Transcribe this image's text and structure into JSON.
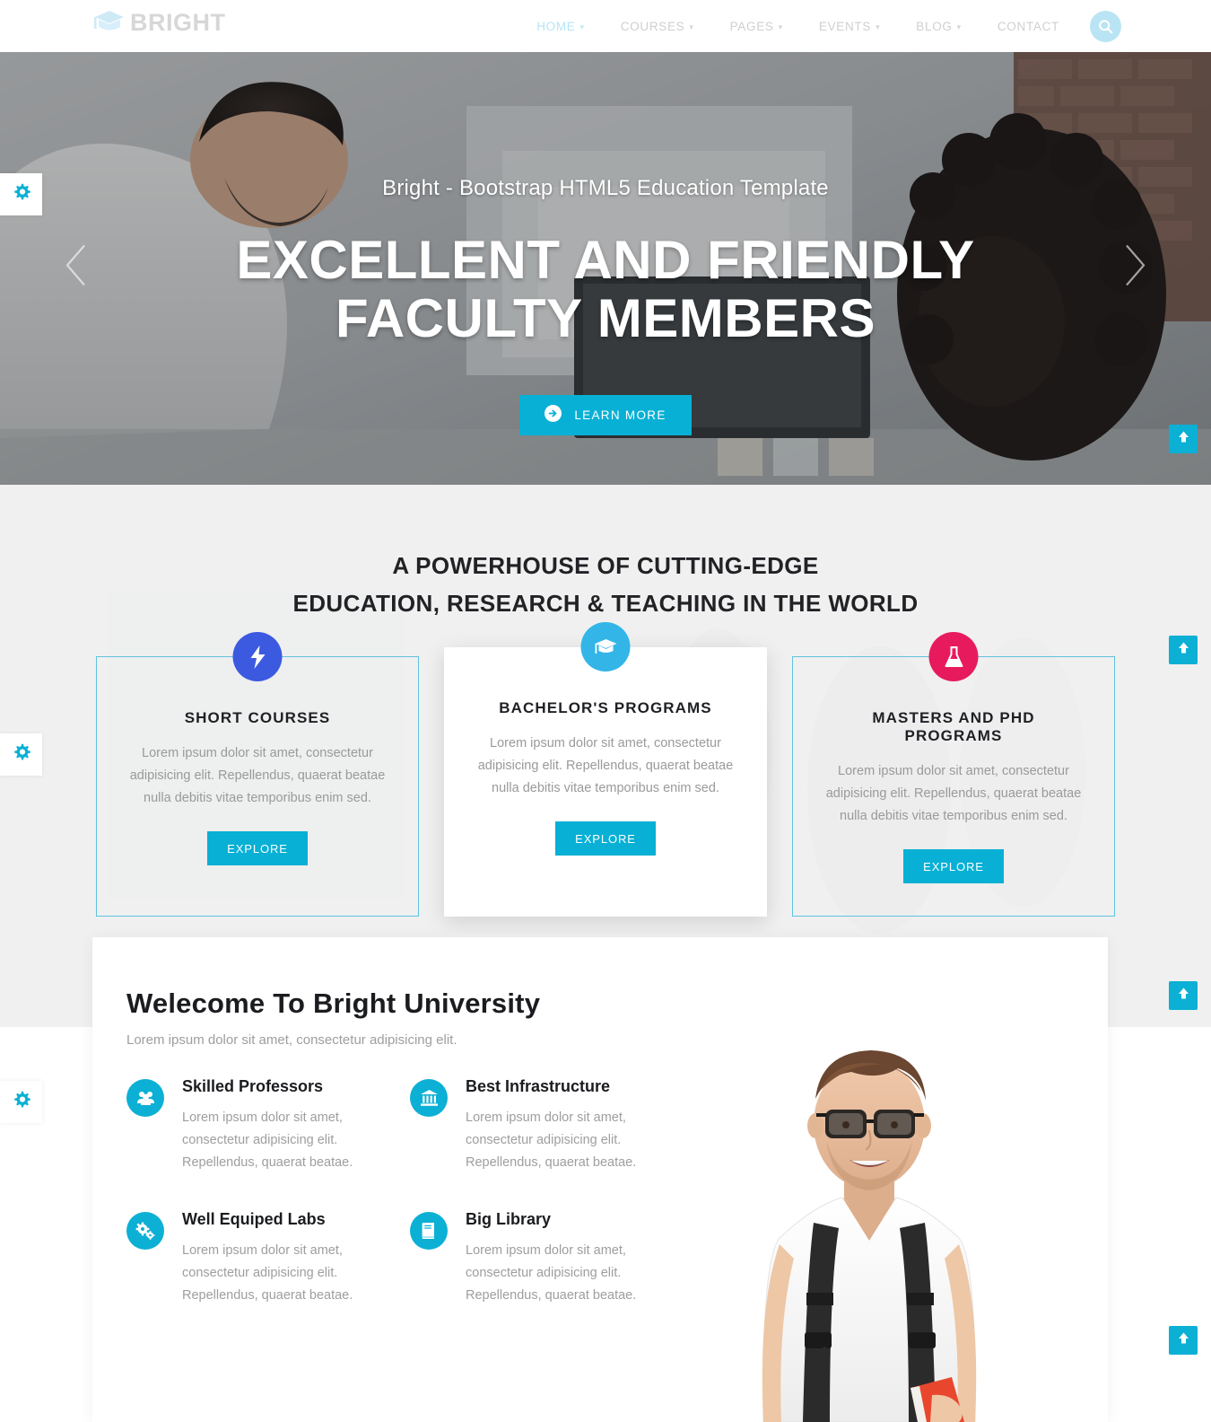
{
  "header": {
    "logo_text": "BRIGHT",
    "logo_icon": "graduation-cap-icon",
    "nav": [
      {
        "label": "HOME",
        "caret": "⌄",
        "active": true
      },
      {
        "label": "COURSES",
        "caret": "⌄",
        "active": false
      },
      {
        "label": "PAGES",
        "caret": "⌄",
        "active": false
      },
      {
        "label": "EVENTS",
        "caret": "⌄",
        "active": false
      },
      {
        "label": "BLOG",
        "caret": "⌄",
        "active": false
      },
      {
        "label": "CONTACT",
        "caret": "",
        "active": false
      }
    ],
    "search_icon": "search-icon"
  },
  "hero": {
    "subtitle": "Bright - Bootstrap HTML5 Education Template",
    "title_line1": "EXCELLENT AND FRIENDLY",
    "title_line2": "FACULTY MEMBERS",
    "button_label": "LEARN MORE",
    "button_icon": "arrow-circle-right-icon",
    "prev_icon": "chevron-left-icon",
    "next_icon": "chevron-right-icon"
  },
  "programs": {
    "heading_line1": "A POWERHOUSE OF CUTTING-EDGE",
    "heading_line2": "EDUCATION, RESEARCH & TEACHING IN THE WORLD",
    "cards": [
      {
        "title": "SHORT COURSES",
        "text": "Lorem ipsum dolor sit amet, consectetur adipisicing elit. Repellendus, quaerat beatae nulla debitis vitae temporibus enim sed.",
        "button": "EXPLORE",
        "icon": "bolt-icon",
        "icon_color": "#3b5ae0",
        "featured": false
      },
      {
        "title": "BACHELOR'S PROGRAMS",
        "text": "Lorem ipsum dolor sit amet, consectetur adipisicing elit. Repellendus, quaerat beatae nulla debitis vitae temporibus enim sed.",
        "button": "EXPLORE",
        "icon": "graduation-cap-icon",
        "icon_color": "#33b5e8",
        "featured": true
      },
      {
        "title": "MASTERS AND PHD PROGRAMS",
        "text": "Lorem ipsum dolor sit amet, consectetur adipisicing elit. Repellendus, quaerat beatae nulla debitis vitae temporibus enim sed.",
        "button": "EXPLORE",
        "icon": "flask-icon",
        "icon_color": "#e81a5e",
        "featured": false
      }
    ]
  },
  "welcome": {
    "title": "Welecome To Bright University",
    "subtitle": "Lorem ipsum dolor sit amet, consectetur adipisicing elit.",
    "features": [
      {
        "title": "Skilled Professors",
        "text": "Lorem ipsum dolor sit amet, consectetur adipisicing elit. Repellendus, quaerat beatae.",
        "icon": "users-icon"
      },
      {
        "title": "Best Infrastructure",
        "text": "Lorem ipsum dolor sit amet, consectetur adipisicing elit. Repellendus, quaerat beatae.",
        "icon": "bank-icon"
      },
      {
        "title": "Well Equiped Labs",
        "text": "Lorem ipsum dolor sit amet, consectetur adipisicing elit. Repellendus, quaerat beatae.",
        "icon": "cogs-icon"
      },
      {
        "title": "Big Library",
        "text": "Lorem ipsum dolor sit amet, consectetur adipisicing elit. Repellendus, quaerat beatae.",
        "icon": "book-icon"
      }
    ],
    "image_alt": "student-photo"
  },
  "widgets": {
    "gear_icon": "gear-icon",
    "scroll_top_icon": "arrow-up-icon"
  },
  "colors": {
    "accent_cyan": "#0bb0d4",
    "nav_active": "#b5e5f5",
    "card_border": "#5fc2de",
    "bolt_blue": "#3b5ae0",
    "flask_pink": "#e81a5e",
    "section_bg": "#f0f0f0"
  }
}
